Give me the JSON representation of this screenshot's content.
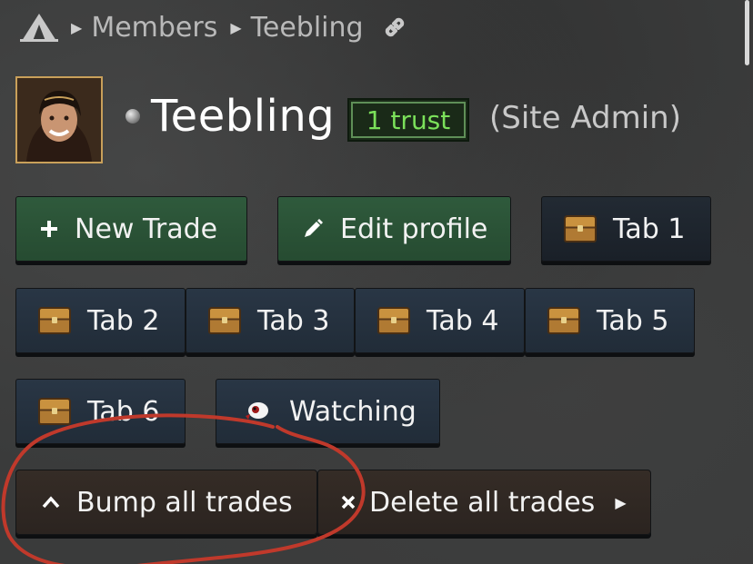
{
  "breadcrumb": {
    "home_icon": "tent-icon",
    "items": [
      "Members",
      "Teebling"
    ],
    "link_icon": "link-icon"
  },
  "profile": {
    "username": "Teebling",
    "trust": "1 trust",
    "role": "(Site Admin)",
    "status": "offline"
  },
  "actions": {
    "new_trade": "New Trade",
    "edit_profile": "Edit profile"
  },
  "tabs": [
    "Tab 1",
    "Tab 2",
    "Tab 3",
    "Tab 4",
    "Tab 5",
    "Tab 6"
  ],
  "watching": "Watching",
  "bulk": {
    "bump": "Bump all trades",
    "delete": "Delete all trades"
  },
  "colors": {
    "green_button": "#2f5a3c",
    "tab_button": "#293645",
    "brown_button": "#352c26",
    "trust_text": "#7be05a",
    "annotation": "#c0392b"
  }
}
